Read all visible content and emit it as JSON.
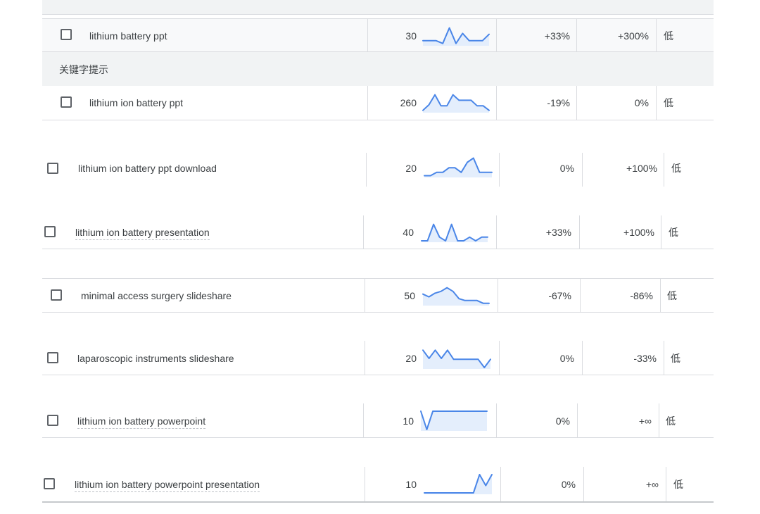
{
  "top_section": {
    "row": {
      "keyword": "lithium battery ppt",
      "searches": "30",
      "change_3m": "+33%",
      "change_yoy": "+300%",
      "competition": "低",
      "trend": [
        0.2,
        0.2,
        0.2,
        0.05,
        0.9,
        0.05,
        0.6,
        0.2,
        0.2,
        0.2,
        0.55
      ]
    },
    "hint_label": "关键字提示",
    "hint_row": {
      "keyword": "lithium ion battery ppt",
      "searches": "260",
      "change_3m": "-19%",
      "change_yoy": "0%",
      "competition": "低",
      "trend": [
        0.05,
        0.35,
        0.9,
        0.3,
        0.3,
        0.9,
        0.6,
        0.6,
        0.6,
        0.3,
        0.3,
        0.05
      ]
    }
  },
  "rows": [
    {
      "keyword": "lithium ion battery ppt download",
      "searches": "20",
      "change_3m": "0%",
      "change_yoy": "+100%",
      "competition": "低",
      "trend": [
        0.02,
        0.02,
        0.2,
        0.2,
        0.45,
        0.45,
        0.2,
        0.75,
        0.98,
        0.2,
        0.2,
        0.2
      ]
    },
    {
      "keyword": "lithium ion battery presentation",
      "searches": "40",
      "change_3m": "+33%",
      "change_yoy": "+100%",
      "competition": "低",
      "trend": [
        0.0,
        0.0,
        0.9,
        0.2,
        0.0,
        0.9,
        0.0,
        0.0,
        0.2,
        0.0,
        0.2,
        0.2
      ]
    },
    {
      "keyword": "minimal access surgery slideshare",
      "searches": "50",
      "change_3m": "-67%",
      "change_yoy": "-86%",
      "competition": "低",
      "trend": [
        0.55,
        0.4,
        0.6,
        0.7,
        0.9,
        0.7,
        0.3,
        0.2,
        0.2,
        0.2,
        0.05,
        0.05
      ]
    },
    {
      "keyword": "laparoscopic instruments slideshare",
      "searches": "20",
      "change_3m": "0%",
      "change_yoy": "-33%",
      "competition": "低",
      "trend": [
        0.95,
        0.5,
        0.95,
        0.5,
        0.95,
        0.45,
        0.45,
        0.45,
        0.45,
        0.45,
        0.0,
        0.45
      ]
    },
    {
      "keyword": "lithium ion battery powerpoint",
      "searches": "10",
      "change_3m": "0%",
      "change_yoy": "+∞",
      "competition": "低",
      "trend": [
        1,
        0.0,
        1,
        1,
        1,
        1,
        1,
        1,
        1,
        1,
        1,
        1
      ]
    },
    {
      "keyword": "lithium ion battery powerpoint presentation",
      "searches": "10",
      "change_3m": "0%",
      "change_yoy": "+∞",
      "competition": "低",
      "trend": [
        0,
        0,
        0,
        0,
        0,
        0,
        0,
        0,
        0,
        1,
        0.4,
        1
      ]
    }
  ]
}
